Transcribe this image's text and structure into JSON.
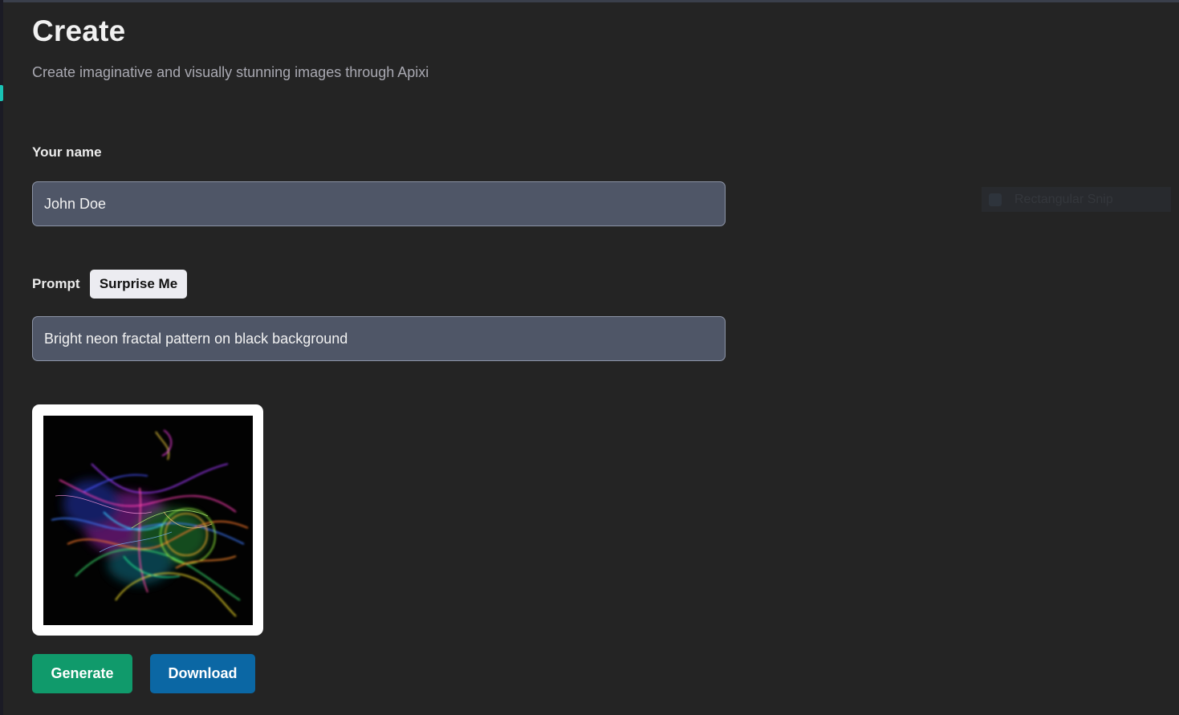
{
  "header": {
    "title": "Create",
    "subtitle": "Create imaginative and visually stunning images through Apixi"
  },
  "form": {
    "name_label": "Your name",
    "name_value": "John Doe",
    "prompt_label": "Prompt",
    "surprise_label": "Surprise Me",
    "prompt_value": "Bright neon fractal pattern on black background"
  },
  "preview": {
    "description_icon": "generated-image"
  },
  "actions": {
    "generate_label": "Generate",
    "download_label": "Download"
  },
  "overlay": {
    "snip_label": "Rectangular Snip"
  },
  "colors": {
    "background": "#242424",
    "field": "#4f5667",
    "generate": "#109a6b",
    "download": "#0b67a4",
    "accent": "#19c3b5"
  }
}
